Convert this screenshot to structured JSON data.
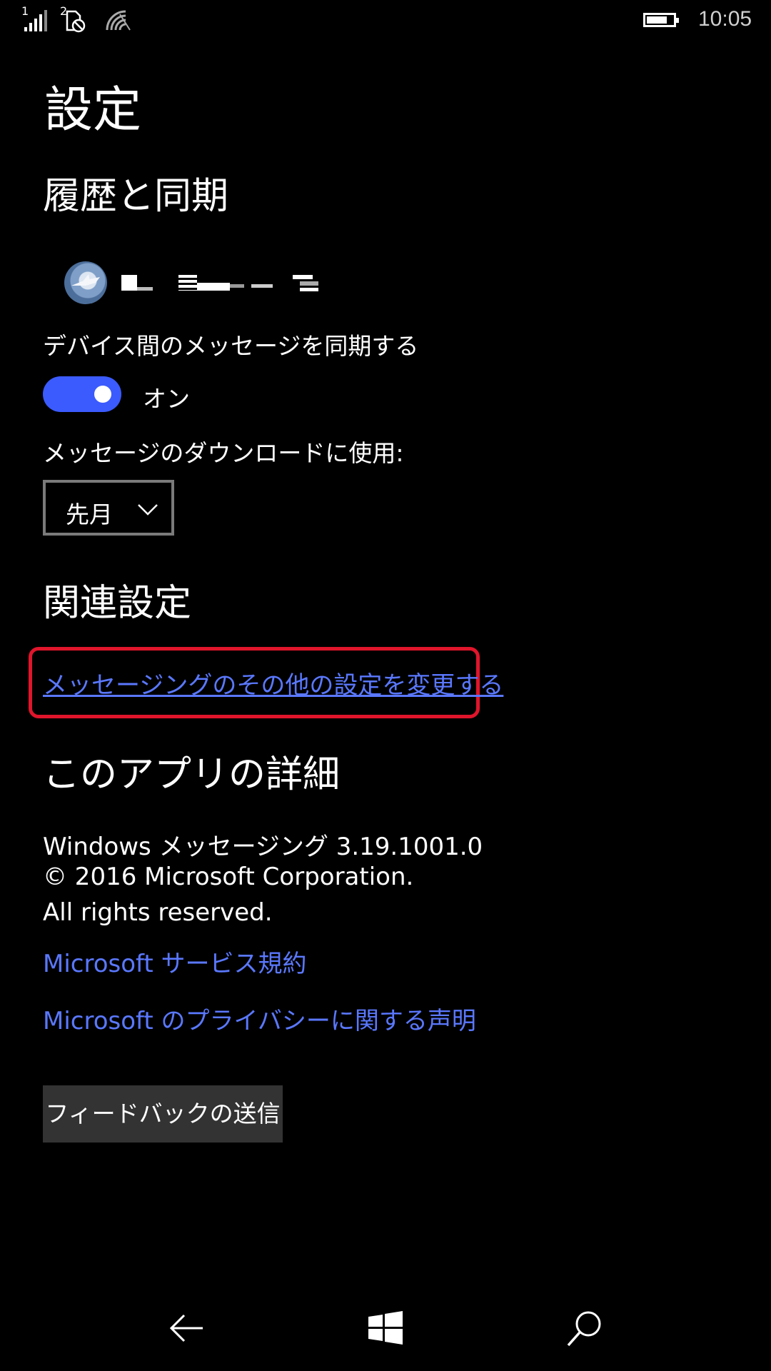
{
  "status_bar": {
    "sim1": "1",
    "sim2": "2",
    "time": "10:05"
  },
  "page": {
    "title": "設定"
  },
  "history_sync": {
    "heading": "履歴と同期",
    "sync_label": "デバイス間のメッセージを同期する",
    "toggle_state": "オン",
    "download_label": "メッセージのダウンロードに使用:",
    "download_value": "先月"
  },
  "related": {
    "heading": "関連設定",
    "link": "メッセージングのその他の設定を変更する"
  },
  "about": {
    "heading": "このアプリの詳細",
    "version": "Windows メッセージング 3.19.1001.0",
    "copyright": "© 2016 Microsoft Corporation.",
    "rights": "All rights reserved.",
    "terms_link": "Microsoft サービス規約",
    "privacy_link": "Microsoft のプライバシーに関する声明",
    "feedback_button": "フィードバックの送信"
  },
  "colors": {
    "accent": "#3b5bfe",
    "link": "#5a78ff",
    "highlight": "#e0152b"
  },
  "icons": {
    "back": "back-arrow-icon",
    "start": "windows-logo-icon",
    "search": "search-icon"
  }
}
